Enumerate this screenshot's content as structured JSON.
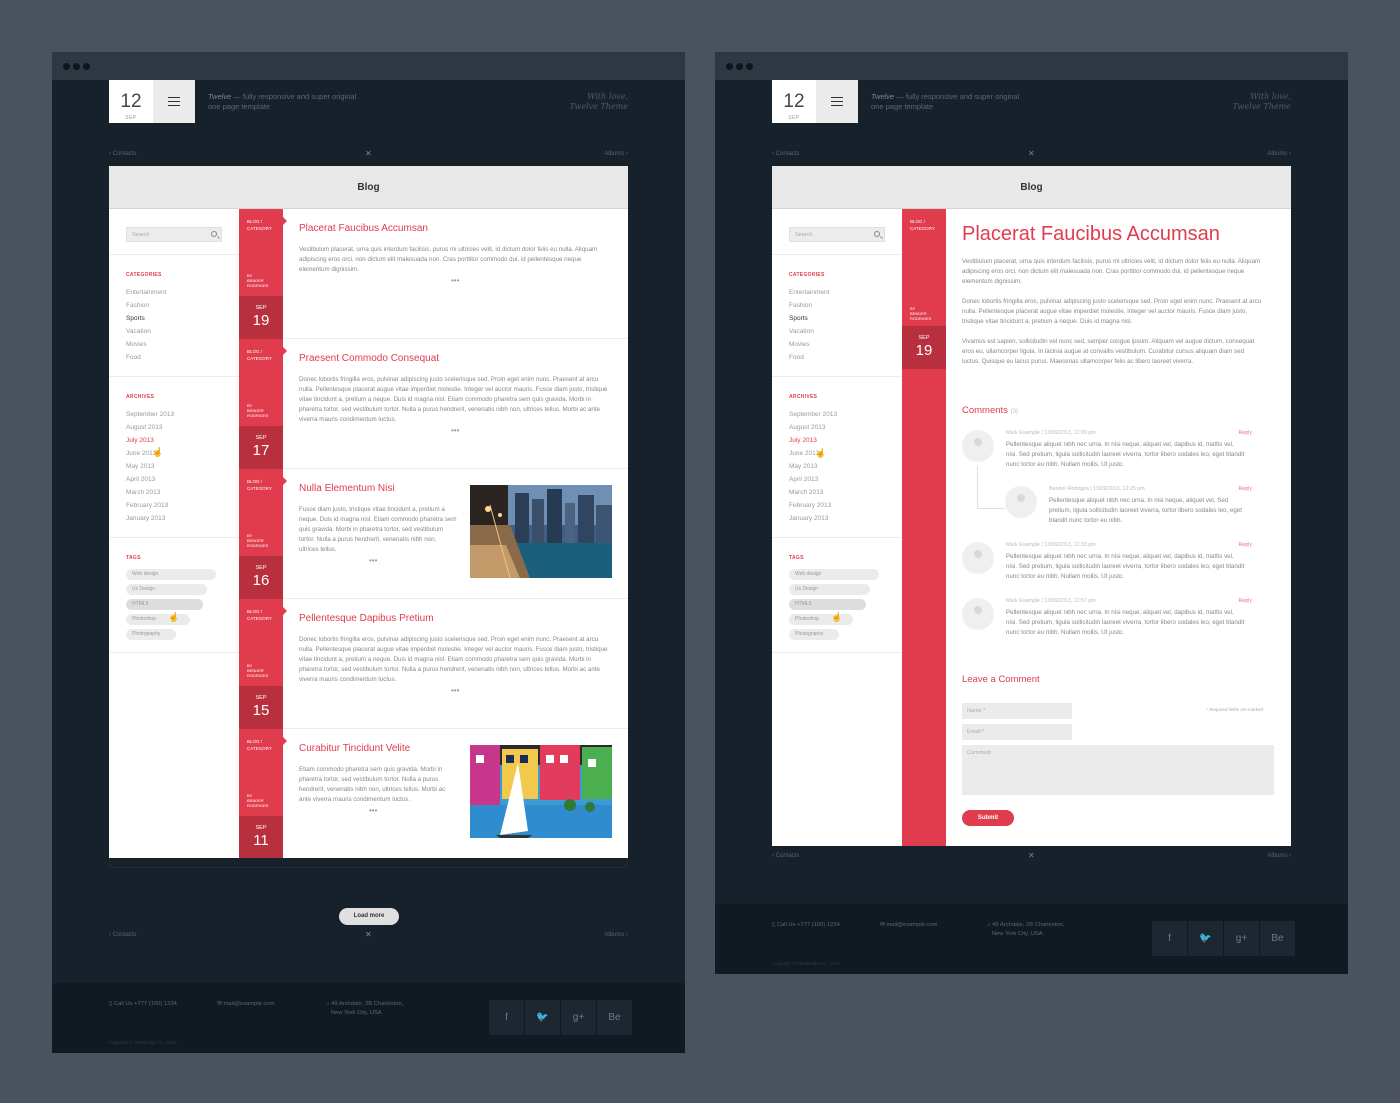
{
  "header": {
    "date_day": "12",
    "date_month": "SEP",
    "tagline_brand": "Twelve",
    "tagline_rest": " — fully responsive and super original",
    "tagline_line2": "one page template",
    "signature_line1": "With love,",
    "signature_line2": "Twelve Theme"
  },
  "nav": {
    "left": "‹ Contacts",
    "close": "✕",
    "right": "Albums ›"
  },
  "blog_title": "Blog",
  "sidebar": {
    "search_placeholder": "Search",
    "categories_title": "CATEGORIES",
    "categories": [
      "Entertainment",
      "Fashion",
      "Sports",
      "Vacation",
      "Movies",
      "Food"
    ],
    "archives_title": "ARCHIVES",
    "archives": [
      "September 2013",
      "August 2013",
      "July 2013",
      "June 2013",
      "May 2013",
      "April 2013",
      "March 2013",
      "February 2013",
      "January 2013"
    ],
    "tags_title": "TAGS",
    "tags": [
      "Web design",
      "Ux Design",
      "HTML5",
      "Photoshop",
      "Photography"
    ]
  },
  "ribbon": {
    "cat_line1": "BLOG /",
    "cat_line2": "CATEGORY",
    "by_line1": "BY",
    "by_line2": "BENDER",
    "by_line3": "RODRIGES"
  },
  "posts": [
    {
      "title": "Placerat Faucibus Accumsan",
      "month": "SEP",
      "day": "19",
      "body": "Vestibulum placerat, urna quis interdum facilisis, purus mi ultricies velit, id dictum dolor felis eu nulla. Aliquam adipiscing eros orci, non dictum elit malesuada non. Cras porttitor commodo dui, id pellentesque neque elementum dignissim.",
      "more": "•••"
    },
    {
      "title": "Praesent Commodo Consequat",
      "month": "SEP",
      "day": "17",
      "body": "Donec lobortis fringilla eros, pulvinar adipiscing justo scelerisque sed. Proin eget enim nunc. Praesent at arcu nulla. Pellentesque placerat augue vitae imperdiet molestie. Integer vel auctor mauris. Fusce diam justo, tristique vitae tincidunt a, pretium a neque. Duis id magna nisl. Etiam commodo pharetra sem quis gravida. Morbi in pharetra tortor, sed vestibulum tortor. Nulla a purus hendrerit, venenatis nibh non, ultrices tellus. Morbi ac ante viverra mauris condimentum luctus.",
      "more": "•••"
    },
    {
      "title": "Nulla Elementum Nisi",
      "month": "SEP",
      "day": "16",
      "body": "Fusce diam justo, tristique vitae tincidunt a, pretium a neque. Duis id magna nisl. Etiam commodo pharetra sem quis gravida. Morbi in pharetra tortor, sed vestibulum tortor. Nulla a purus hendrerit, venenatis nibh non, ultrices tellus.",
      "more": "•••"
    },
    {
      "title": "Pellentesque Dapibus Pretium",
      "month": "SEP",
      "day": "15",
      "body": "Donec lobortis fringilla eros, pulvinar adipiscing justo scelerisque sed. Proin eget enim nunc. Praesent at arcu nulla. Pellentesque placerat augue vitae imperdiet molestie. Integer vel auctor mauris. Fusce diam justo, tristique vitae tincidunt a, pretium a neque. Duis id magna nisl. Etiam commodo pharetra sem quis gravida. Morbi in pharetra tortor, sed vestibulum tortor. Nulla a purus hendrerit, venenatis nibh non, ultrices tellus. Morbi ac ante viverra mauris condimentum luctus.",
      "more": "•••"
    },
    {
      "title": "Curabitur Tincidunt Velite",
      "month": "SEP",
      "day": "11",
      "body": "Etiam commodo pharetra sem quis gravida. Morbi in pharetra tortor, sed vestibulum tortor. Nulla a purus hendrerit, venenatis nibh non, ultrices tellus. Morbi ac ante viverra mauris condimentum luctus.",
      "more": "•••"
    }
  ],
  "load_more": "Load more",
  "footer": {
    "phone": "Call Us +777 (100) 1234",
    "email": "mail@example.com",
    "address_line1": "49 Archdale, 2B Charleston,",
    "address_line2": "New York City, USA",
    "social": [
      "f",
      "🐦",
      "g+",
      "Be"
    ],
    "copyright": "Copyright © ItemBridge inc., 2013"
  },
  "single": {
    "title": "Placerat Faucibus Accumsan",
    "month": "SEP",
    "day": "19",
    "paragraphs": [
      "Vestibulum placerat, urna quis interdum facilisis, purus mi ultricies velit, id dictum dolor felis eu nulla. Aliquam adipiscing eros orci, non dictum elit malesuada non. Cras porttitor commodo dui, id pellentesque neque elementum dignissim.",
      "Donec lobortis fringilla eros, pulvinar adipiscing justo scelerisque sed. Proin eget enim nunc. Praesent at arcu nulla. Pellentesque placerat augue vitae imperdiet molestie. Integer vel auctor mauris. Fusce diam justo, tristique vitae tincidunt a, pretium a neque. Duis id magna nisl.",
      "Vivamus est sapien, sollicitudin vel nunc sed, semper congue ipsum. Aliquam vel augue dictum, consequat eros eu, ullamcorper ligula. In lacinia augue at convallis vestibulum. Curabitur cursus aliquam diam sed luctus. Quisque eu lacus purus. Maecenas ullamcorper felis ac libero laoreet viverra."
    ],
    "comments_title": "Comments",
    "comments_count": "(3)",
    "comments": [
      {
        "meta": "Mark Example  |  13/09/2013, 12:09 pm",
        "reply": "Reply",
        "text": "Pellentesque aliquet nibh nec urna. In nisi neque, aliquet vel, dapibus id, mattis vel, nisi. Sed pretium, ligula sollicitudin laoreet viverra, tortor libero sodales leo, eget blandit nunc tortor eu nibh. Nullam mollis. Ut justo."
      },
      {
        "meta": "Bender Rodriges  |  13/09/2013, 12:25 pm",
        "reply": "Reply",
        "text": "Pellentesque aliquet nibh nec urna. In nisi neque, aliquet vel, Sed pretium, ligula sollicitudin laoreet viverra, tortor libero sodales leo, eget blandit nunc tortor eu nibh."
      },
      {
        "meta": "Mark Example  |  13/09/2013, 12:33 pm",
        "reply": "Reply",
        "text": "Pellentesque aliquet nibh nec urna. In nisi neque, aliquet vel, dapibus id, mattis vel, nisi. Sed pretium, ligula sollicitudin laoreet viverra, tortor libero sodales leo, eget blandit nunc tortor eu nibh. Nullam mollis. Ut justo."
      },
      {
        "meta": "Mark Example  |  13/09/2013, 12:57 pm",
        "reply": "Reply",
        "text": "Pellentesque aliquet nibh nec urna. In nisi neque, aliquet vel, dapibus id, mattis vel, nisi. Sed pretium, ligula sollicitudin laoreet viverra, tortor libero sodales leo, eget blandit nunc tortor eu nibh. Nullam mollis. Ut justo."
      }
    ],
    "leave_comment": "Leave a Comment",
    "name_placeholder": "Name *",
    "email_placeholder": "Email *",
    "comment_placeholder": "Comment",
    "required_note": "* Required fields are marked",
    "submit": "Submit"
  },
  "colors": {
    "accent": "#e03c4d",
    "dark_bg": "#17212b",
    "outer_bg": "#4a535d"
  }
}
